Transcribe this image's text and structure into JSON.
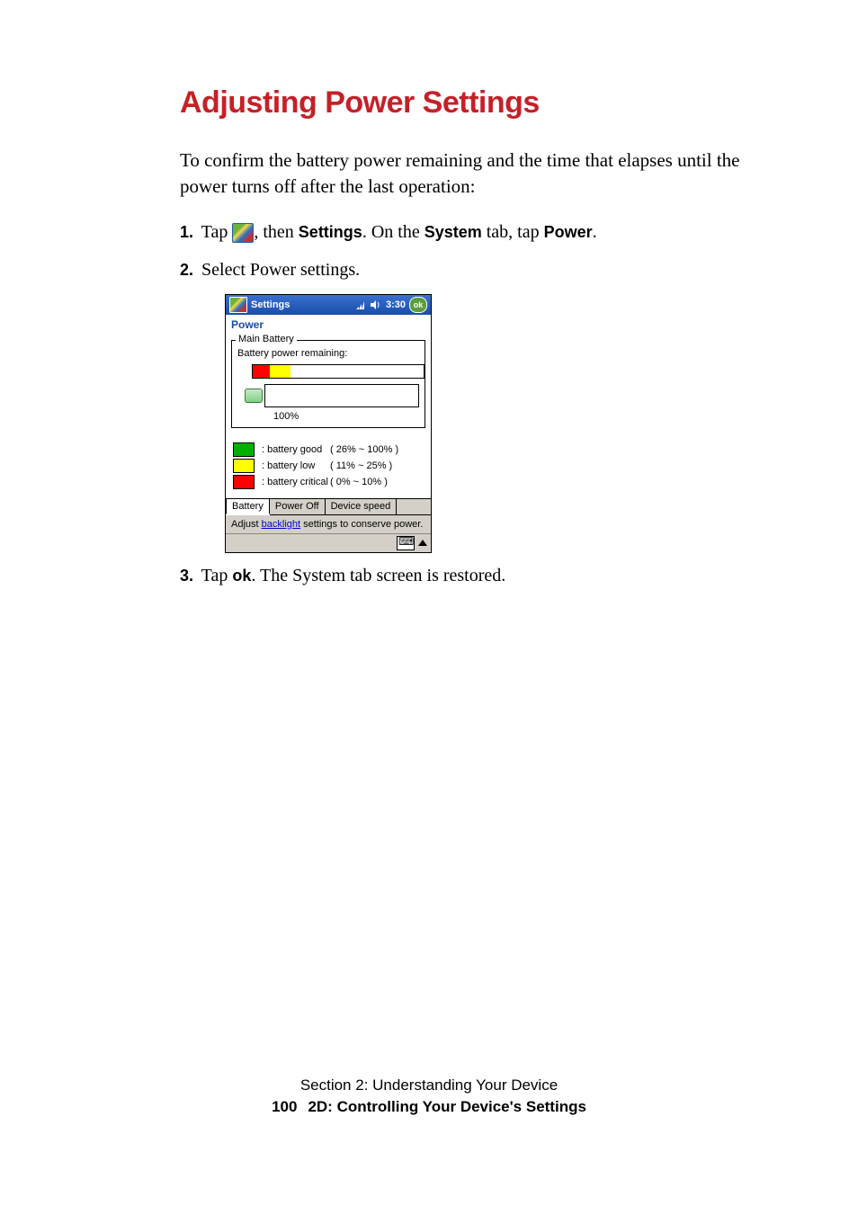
{
  "heading": "Adjusting Power Settings",
  "intro": "To confirm the battery power remaining and the time that elapses until the power turns off after the last operation:",
  "step1": {
    "num": "1.",
    "t1": " Tap ",
    "t2": ", then ",
    "settings": "Settings",
    "t3": ". On the ",
    "system": "System",
    "t4": " tab, tap ",
    "power": "Power",
    "t5": "."
  },
  "step2": {
    "num": "2.",
    "text": " Select Power settings."
  },
  "step3": {
    "num": "3.",
    "t1": " Tap ",
    "ok": "ok",
    "t2": ". The System tab screen is restored."
  },
  "ppc": {
    "titlebar": {
      "title": "Settings",
      "time": "3:30",
      "ok": "ok"
    },
    "power_label": "Power",
    "group_legend": "Main Battery",
    "remaining_label": "Battery power remaining:",
    "pct": "100%",
    "legend": {
      "good": {
        "label": ": battery good",
        "range": "( 26% ~ 100% )"
      },
      "low": {
        "label": ": battery low",
        "range": "( 11% ~  25% )"
      },
      "crit": {
        "label": ": battery critical",
        "range": "(  0%  ~  10% )"
      }
    },
    "tabs": {
      "t1": "Battery",
      "t2": "Power Off",
      "t3": "Device speed"
    },
    "hint_pre": "Adjust ",
    "hint_link": "backlight",
    "hint_post": " settings to conserve power."
  },
  "footer": {
    "line1": "Section 2: Understanding Your Device",
    "page_number": "100",
    "line2": "2D: Controlling Your Device's Settings"
  }
}
